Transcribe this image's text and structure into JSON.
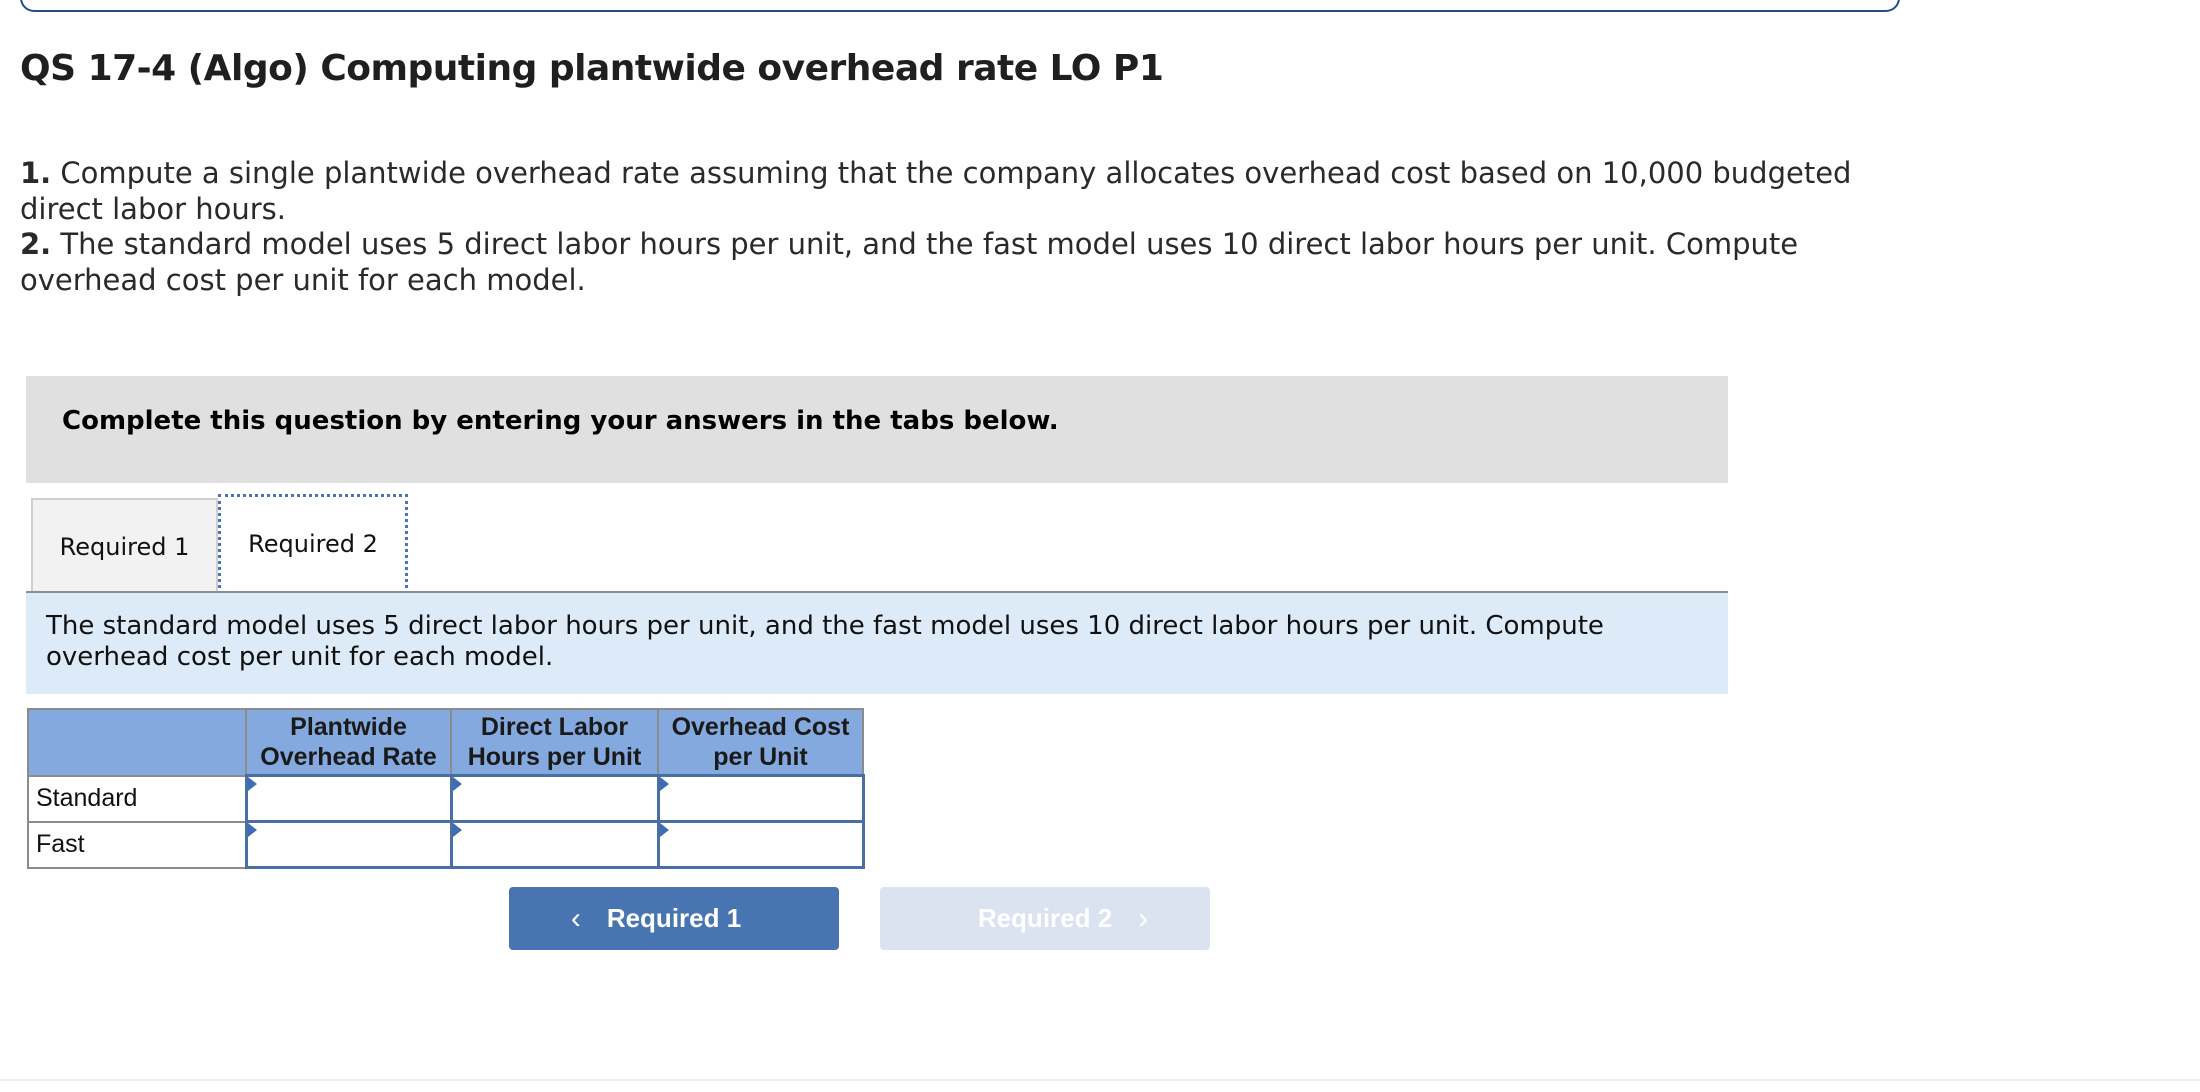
{
  "header": {
    "title": "QS 17-4 (Algo) Computing plantwide overhead rate LO P1"
  },
  "instructions": [
    {
      "number": "1.",
      "text": " Compute a single plantwide overhead rate assuming that the company allocates overhead cost based on 10,000 budgeted direct labor hours."
    },
    {
      "number": "2.",
      "text": " The standard model uses 5 direct labor hours per unit, and the fast model uses 10 direct labor hours per unit. Compute overhead cost per unit for each model."
    }
  ],
  "panel": {
    "heading": "Complete this question by entering your answers in the tabs below."
  },
  "tabs": [
    {
      "label": "Required 1",
      "active": false
    },
    {
      "label": "Required 2",
      "active": true
    }
  ],
  "tab_content": {
    "description": "The standard model uses 5 direct labor hours per unit, and the fast model uses 10 direct labor hours per unit. Compute overhead cost per unit for each model."
  },
  "table": {
    "columns": [
      "",
      "Plantwide Overhead Rate",
      "Direct Labor Hours per Unit",
      "Overhead Cost per Unit"
    ],
    "rows": [
      {
        "label": "Standard",
        "values": [
          "",
          "",
          ""
        ]
      },
      {
        "label": "Fast",
        "values": [
          "",
          "",
          ""
        ]
      }
    ]
  },
  "navigation": {
    "prev": {
      "label": "Required 1",
      "icon": "chevron-left-icon",
      "glyph": "‹"
    },
    "next": {
      "label": "Required 2",
      "icon": "chevron-right-icon",
      "glyph": "›",
      "disabled": true
    }
  },
  "colors": {
    "accent": "#4874b2",
    "table_header": "#84a9de",
    "description_bg": "#ddeaf7",
    "panel_bg": "#e0e0e0"
  }
}
